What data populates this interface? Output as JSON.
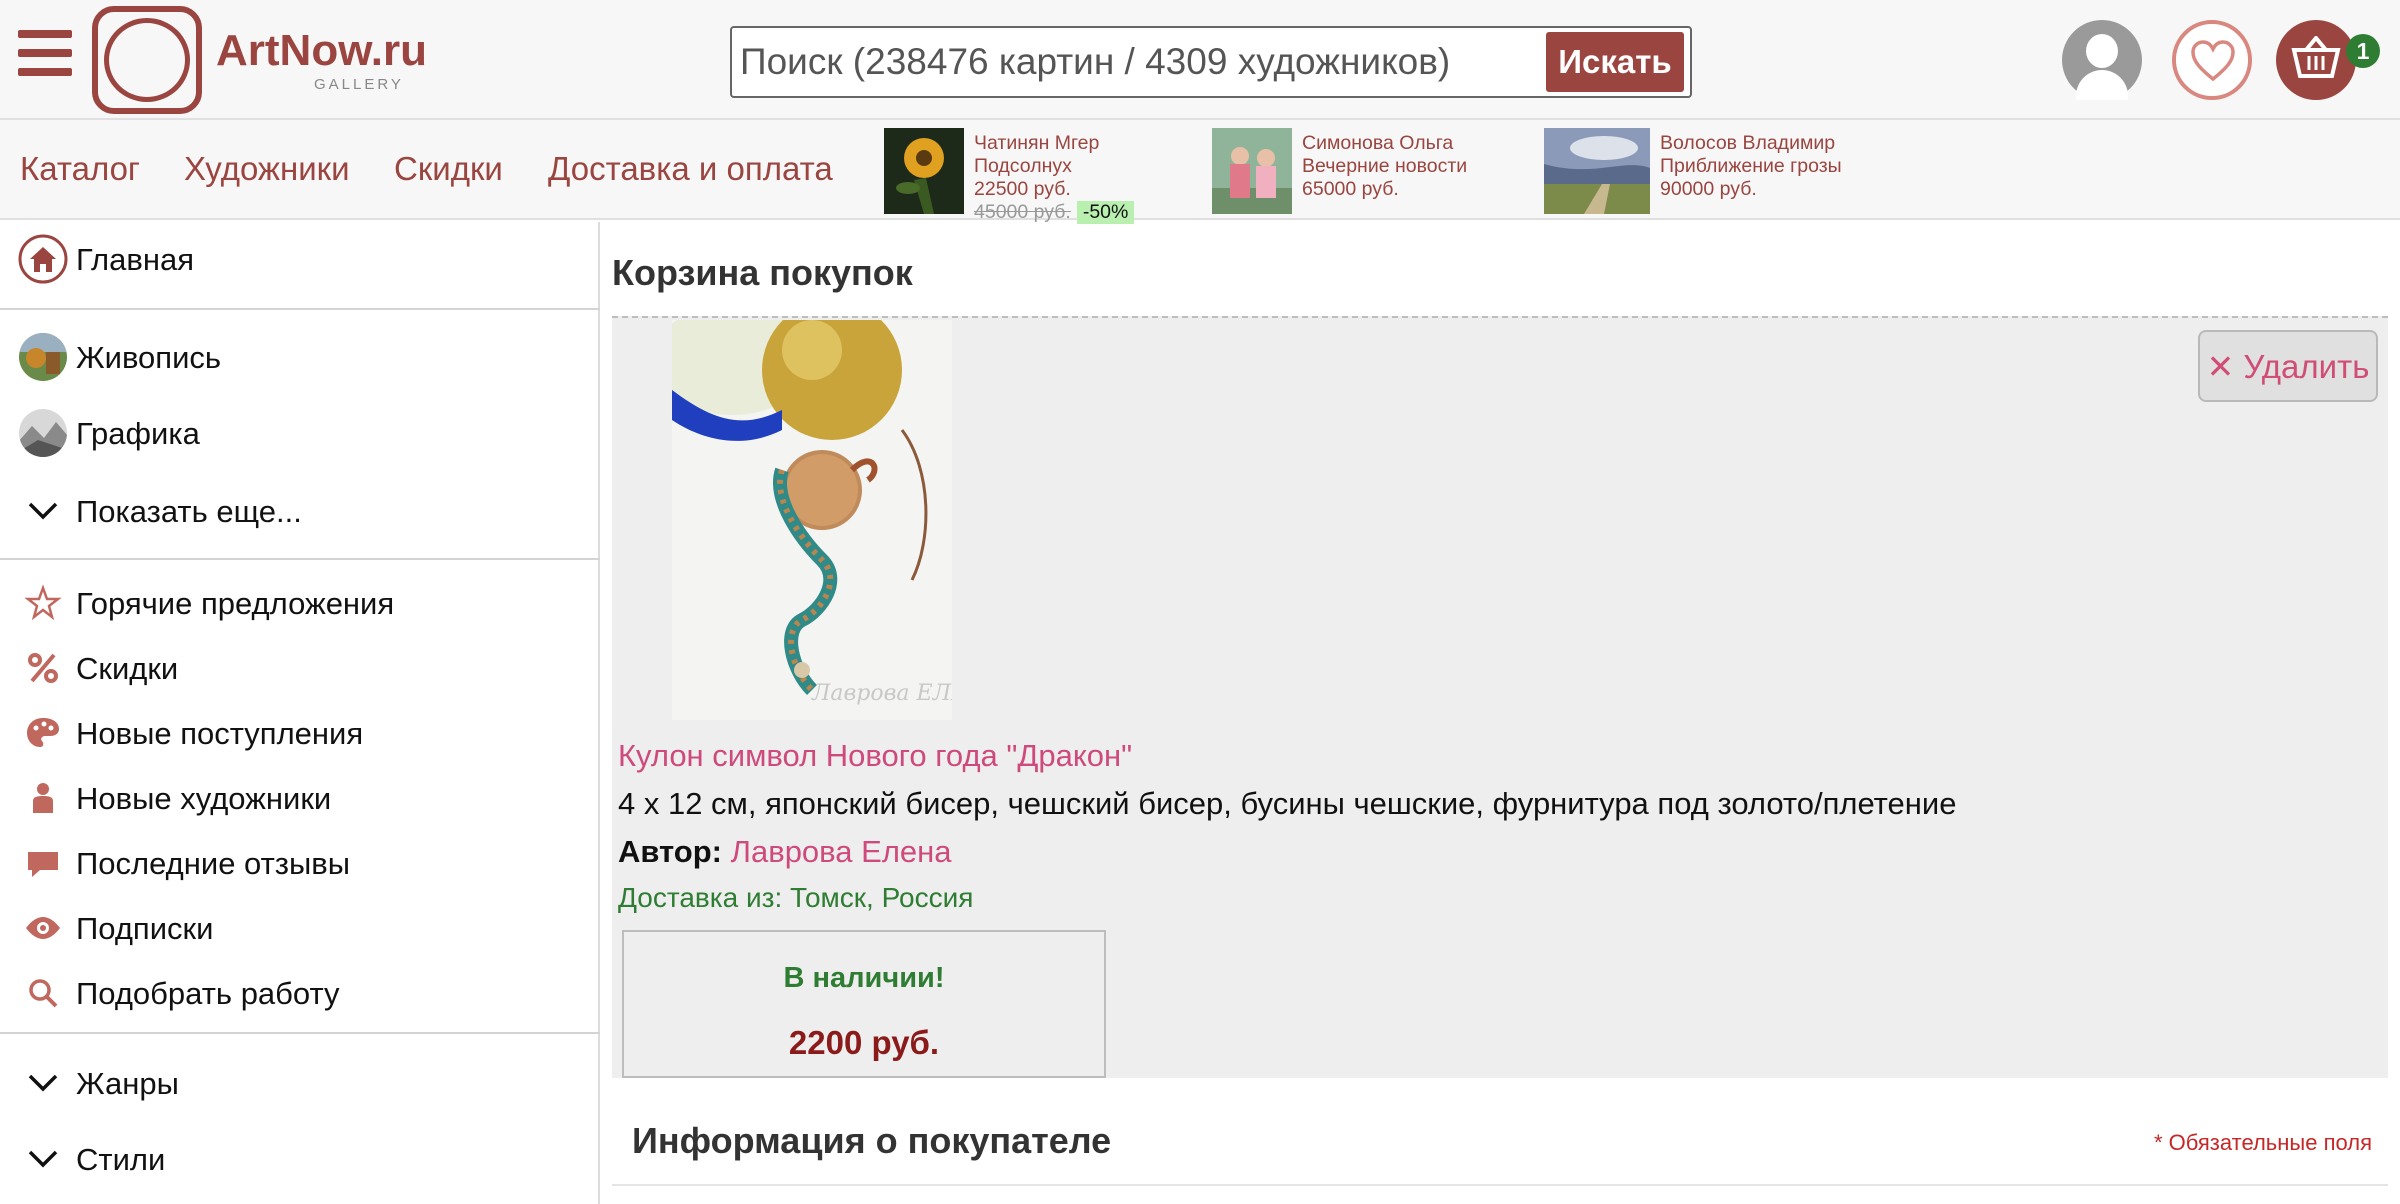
{
  "header": {
    "logo_name": "ArtNow.ru",
    "logo_sub": "GALLERY",
    "search_placeholder": "Поиск (238476 картин / 4309 художников)",
    "search_button": "Искать",
    "cart_count": "1"
  },
  "nav": {
    "links": [
      "Каталог",
      "Художники",
      "Скидки",
      "Доставка и оплата"
    ],
    "promos": [
      {
        "artist": "Чатинян Мгер",
        "title": "Подсолнух",
        "price": "22500 руб.",
        "old_price": "45000 руб.",
        "discount": "-50%"
      },
      {
        "artist": "Симонова Ольга",
        "title": "Вечерние новости",
        "price": "65000 руб."
      },
      {
        "artist": "Волосов Владимир",
        "title": "Приближение грозы",
        "price": "90000 руб."
      }
    ]
  },
  "sidebar": {
    "home": "Главная",
    "categories": [
      "Живопись",
      "Графика"
    ],
    "show_more": "Показать еще...",
    "menu": [
      "Горячие предложения",
      "Скидки",
      "Новые поступления",
      "Новые художники",
      "Последние отзывы",
      "Подписки",
      "Подобрать работу"
    ],
    "sections": [
      "Жанры",
      "Стили"
    ]
  },
  "main": {
    "title": "Корзина покупок",
    "delete_label": "Удалить",
    "item": {
      "title": "Кулон символ Нового года \"Дракон\"",
      "description": "4 x 12 см, японский бисер, чешский бисер, бусины чешские, фурнитура под золото/плетение",
      "author_label": "Автор:",
      "author": "Лаврова Елена",
      "delivery": "Доставка из: Томск, Россия",
      "stock": "В наличии!",
      "price": "2200 руб.",
      "watermark": "Лаврова ЕЛЕНА"
    },
    "buyer_title": "Информация о покупателе",
    "required_note": "* Обязательные поля"
  },
  "colors": {
    "brand": "#9a4540",
    "link_pink": "#cf4a7c",
    "green": "#2e7d32",
    "price_red": "#8b1a1a"
  }
}
